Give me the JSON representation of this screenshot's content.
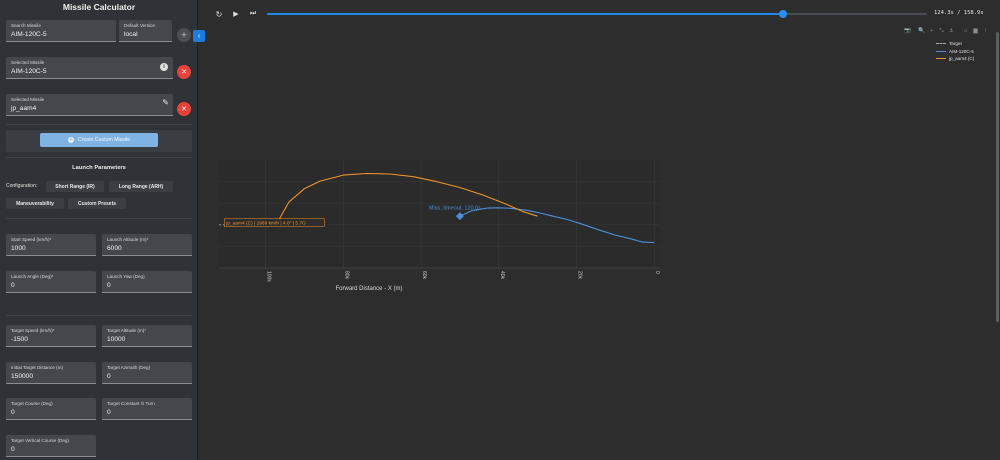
{
  "sidebar": {
    "title": "Missile Calculator",
    "search_missile": {
      "label": "Search Missile",
      "value": "AIM-120C-5"
    },
    "default_version": {
      "label": "Default Version",
      "value": "local"
    },
    "add_icon": "+",
    "selected_1": {
      "label": "Selected Missile",
      "value": "AIM-120C-5",
      "info_icon": "i"
    },
    "selected_2": {
      "label": "Selected Missile",
      "value": "jp_aam4",
      "edit_icon": "✎"
    },
    "remove_icon": "✕",
    "create_button": "Create Custom Missile",
    "create_icon": "+",
    "launch_parameters_title": "Launch Parameters",
    "configuration_label": "Configuration:",
    "chips": [
      "Short Range (IR)",
      "Long Range (ARH)",
      "Maneuverability",
      "Custom Presets"
    ],
    "fields": [
      {
        "label": "Start Speed (km/h)*",
        "value": "1000"
      },
      {
        "label": "Launch Altitude (m)*",
        "value": "6000"
      },
      {
        "label": "Launch Angle (Deg)*",
        "value": "0"
      },
      {
        "label": "Launch Yaw (Deg)",
        "value": "0"
      },
      {
        "label": "Target Speed (km/h)*",
        "value": "-1500"
      },
      {
        "label": "Target Altitude (m)*",
        "value": "10000"
      },
      {
        "label": "Initial Target Distance (m)",
        "value": "150000"
      },
      {
        "label": "Target Azimuth (Deg)",
        "value": "0"
      },
      {
        "label": "Target Course (Deg)",
        "value": "0"
      },
      {
        "label": "Target Constant G Turn",
        "value": "0"
      },
      {
        "label": "Target Vertical Course (Deg)",
        "value": "0"
      }
    ],
    "collapse_icon": "‹"
  },
  "playback": {
    "replay_icon": "↻",
    "play_icon": "▶",
    "skip_icon": "⏭",
    "progress": 0.782,
    "time_readout": "124.3s / 158.9s"
  },
  "modebar_icons": [
    "📷",
    "🔍",
    "+",
    "⤡",
    "⚓",
    "⌂",
    "▆",
    "⁞"
  ],
  "colors": {
    "accent": "#2287e6",
    "aim120": "#4a90d9",
    "jp_aam4": "#f0922b",
    "target": "#aaaaaa",
    "danger": "#e8433b"
  },
  "chart_data": {
    "type": "line",
    "xlabel": "Forward Distance - X (m)",
    "x_ticks": [
      "100k",
      "80k",
      "60k",
      "40k",
      "20k",
      "0"
    ],
    "x_tick_values": [
      100000,
      80000,
      60000,
      40000,
      20000,
      0
    ],
    "xlim": [
      112000,
      -1500
    ],
    "ylim": [
      2000,
      22000
    ],
    "legend": [
      "Target",
      "AIM-120C-5",
      "jp_aam4 (C)"
    ],
    "series": [
      {
        "name": "Target",
        "style": "dashed",
        "x": [
          112000,
          101000
        ],
        "y": [
          10000,
          10000
        ]
      },
      {
        "name": "AIM-120C-5",
        "x": [
          50000,
          47000,
          43000,
          40000,
          37000,
          33000,
          30000,
          26000,
          22000,
          18000,
          14000,
          10000,
          6000,
          3000,
          0
        ],
        "y": [
          11600,
          12600,
          13100,
          13150,
          13050,
          12700,
          12300,
          11600,
          10900,
          10000,
          9000,
          8100,
          7400,
          6800,
          6700
        ]
      },
      {
        "name": "jp_aam4 (C)",
        "x": [
          97000,
          94000,
          90000,
          86000,
          80000,
          74000,
          68000,
          62000,
          56000,
          50000,
          44000,
          38000,
          34000,
          30000
        ],
        "y": [
          10400,
          14200,
          16700,
          18100,
          19200,
          19500,
          19400,
          18900,
          18000,
          16900,
          15500,
          13800,
          12500,
          11600
        ]
      }
    ],
    "annotations": [
      {
        "text": "jp_aam4 (C) | 1989 km/h | 4.0° | 5.7G",
        "x": 97000,
        "y": 10400
      },
      {
        "text": "Miss, timeout, 120.0s",
        "x": 50000,
        "y": 12800
      }
    ]
  }
}
